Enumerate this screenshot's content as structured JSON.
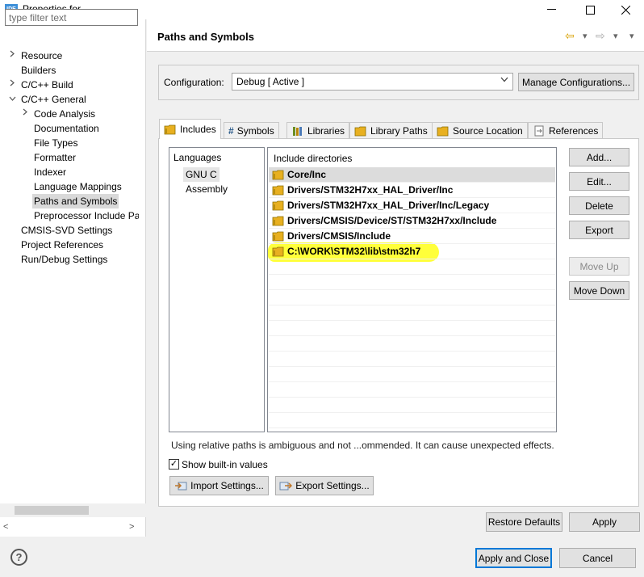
{
  "window": {
    "app_icon_text": "IDE",
    "title": "Properties for",
    "minimize": "—",
    "maximize": "☐",
    "close": "✕"
  },
  "sidebar": {
    "filter_placeholder": "type filter text",
    "items": [
      {
        "label": "Resource",
        "chevron": ">"
      },
      {
        "label": "Builders",
        "chevron": ""
      },
      {
        "label": "C/C++ Build",
        "chevron": ">"
      },
      {
        "label": "C/C++ General",
        "chevron": "v"
      },
      {
        "label": "Code Analysis",
        "chevron": ">"
      },
      {
        "label": "Documentation",
        "chevron": ""
      },
      {
        "label": "File Types",
        "chevron": ""
      },
      {
        "label": "Formatter",
        "chevron": ""
      },
      {
        "label": "Indexer",
        "chevron": ""
      },
      {
        "label": "Language Mappings",
        "chevron": ""
      },
      {
        "label": "Paths and Symbols",
        "chevron": "",
        "selected": true
      },
      {
        "label": "Preprocessor Include Pat",
        "chevron": ""
      },
      {
        "label": "CMSIS-SVD Settings",
        "chevron": ""
      },
      {
        "label": "Project References",
        "chevron": ""
      },
      {
        "label": "Run/Debug Settings",
        "chevron": ""
      }
    ],
    "scroll_left": "<",
    "scroll_right": ">"
  },
  "header": {
    "title": "Paths and Symbols",
    "back_icon": "⇦",
    "forward_icon": "⇨",
    "menu_icon": "▾"
  },
  "configuration": {
    "label": "Configuration:",
    "selected": "Debug  [ Active ]",
    "manage_button": "Manage Configurations..."
  },
  "tabs": [
    {
      "label": "Includes",
      "icon": "folder-icon",
      "active": true
    },
    {
      "label": "Symbols",
      "icon": "hash-icon",
      "glyph": "#"
    },
    {
      "label": "Libraries",
      "icon": "library-icon"
    },
    {
      "label": "Library Paths",
      "icon": "folder-icon"
    },
    {
      "label": "Source Location",
      "icon": "folder-icon"
    },
    {
      "label": "References",
      "icon": "references-icon"
    }
  ],
  "languages": {
    "header": "Languages",
    "items": [
      {
        "label": "GNU C",
        "selected": true
      },
      {
        "label": "Assembly"
      }
    ]
  },
  "include_directories": {
    "header": "Include directories",
    "items": [
      "Core/Inc",
      "Drivers/STM32H7xx_HAL_Driver/Inc",
      "Drivers/STM32H7xx_HAL_Driver/Inc/Legacy",
      "Drivers/CMSIS/Device/ST/STM32H7xx/Include",
      "Drivers/CMSIS/Include",
      "C:\\WORK\\STM32\\lib\\stm32h7"
    ],
    "highlight_color": "#ffff3a"
  },
  "side_buttons": {
    "add": "Add...",
    "edit": "Edit...",
    "delete": "Delete",
    "export": "Export",
    "move_up": "Move Up",
    "move_down": "Move Down"
  },
  "status_text": "Using relative paths is ambiguous and not ...ommended. It can cause unexpected effects.",
  "show_builtin": {
    "label": "Show built-in values",
    "checked": true,
    "mark": "✓"
  },
  "settings_buttons": {
    "import": "Import Settings...",
    "export": "Export Settings..."
  },
  "footer": {
    "help": "?",
    "restore_defaults": "Restore Defaults",
    "apply": "Apply",
    "apply_and_close": "Apply and Close",
    "cancel": "Cancel"
  },
  "colors": {
    "accent": "#0078d7",
    "folder": "#e8b020"
  }
}
